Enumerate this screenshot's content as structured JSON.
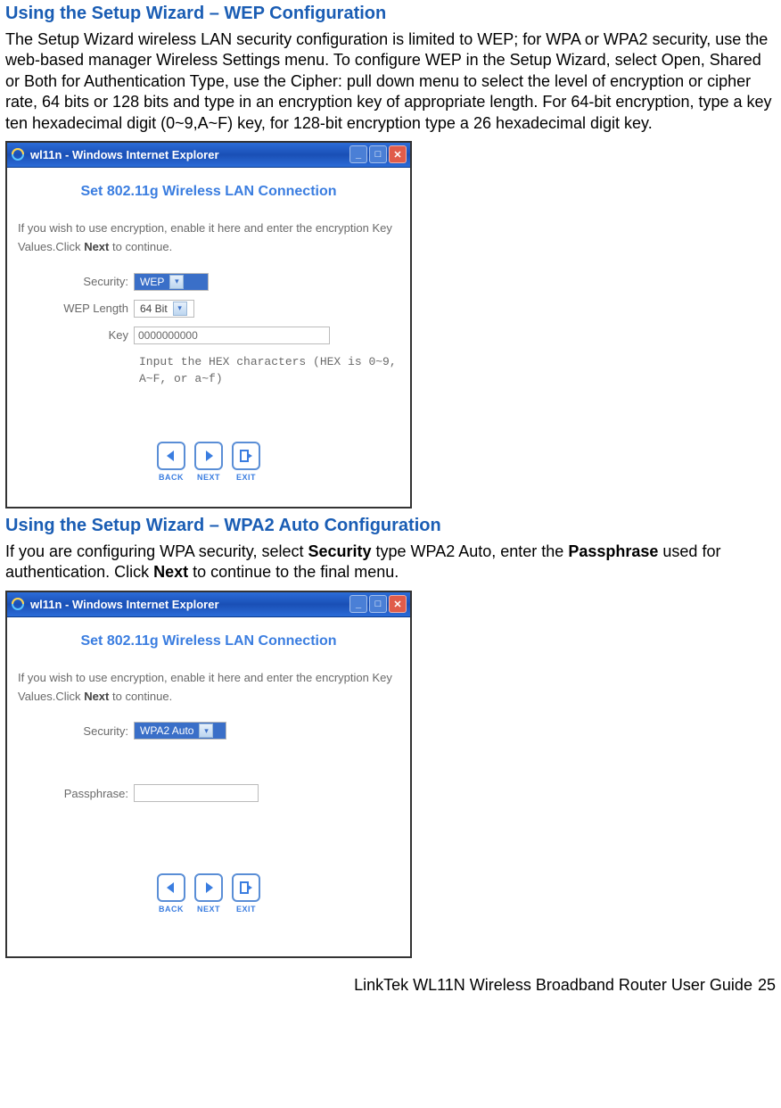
{
  "section1": {
    "heading": "Using the Setup Wizard – WEP Configuration",
    "para": "The Setup Wizard wireless LAN security configuration is limited to WEP; for WPA or WPA2 security, use the web-based manager Wireless Settings menu. To configure WEP in the Setup Wizard, select Open, Shared or Both for Authentication Type, use the Cipher: pull down menu to select the level of encryption or cipher rate, 64 bits or 128 bits and type in an encryption key of appropriate length. For 64-bit encryption, type a key ten hexadecimal digit (0~9,A~F) key, for 128-bit encryption type a 26 hexadecimal digit key."
  },
  "window1": {
    "title": "wl11n - Windows Internet Explorer",
    "wizard_title": "Set 802.11g Wireless LAN Connection",
    "instruction_a": "If you wish to use encryption, enable it here and enter the encryption Key",
    "instruction_b": "Values.Click ",
    "instruction_b_bold": "Next",
    "instruction_b_tail": " to continue.",
    "labels": {
      "security": "Security:",
      "wep_length": "WEP Length",
      "key": "Key"
    },
    "values": {
      "security": "WEP",
      "wep_length": "64 Bit",
      "key": "0000000000"
    },
    "hint": "Input the HEX characters (HEX is 0~9, A~F, or a~f)",
    "nav": {
      "back": "BACK",
      "next": "NEXT",
      "exit": "EXIT"
    }
  },
  "section2": {
    "heading": "Using the Setup Wizard – WPA2 Auto Configuration",
    "para_a": "If you are configuring WPA security, select ",
    "para_b_bold": "Security",
    "para_c": " type WPA2 Auto, enter the ",
    "para_d_bold": "Passphrase",
    "para_e": " used for authentication. Click ",
    "para_f_bold": "Next",
    "para_g": " to continue to the final menu."
  },
  "window2": {
    "title": "wl11n - Windows Internet Explorer",
    "wizard_title": "Set 802.11g Wireless LAN Connection",
    "instruction_a": "If you wish to use encryption, enable it here and enter the encryption Key",
    "instruction_b": "Values.Click ",
    "instruction_b_bold": "Next",
    "instruction_b_tail": " to continue.",
    "labels": {
      "security": "Security:",
      "passphrase": "Passphrase:"
    },
    "values": {
      "security": "WPA2 Auto",
      "passphrase": ""
    },
    "nav": {
      "back": "BACK",
      "next": "NEXT",
      "exit": "EXIT"
    }
  },
  "footer": {
    "text": "LinkTek WL11N Wireless Broadband Router User Guide",
    "page": "25"
  }
}
